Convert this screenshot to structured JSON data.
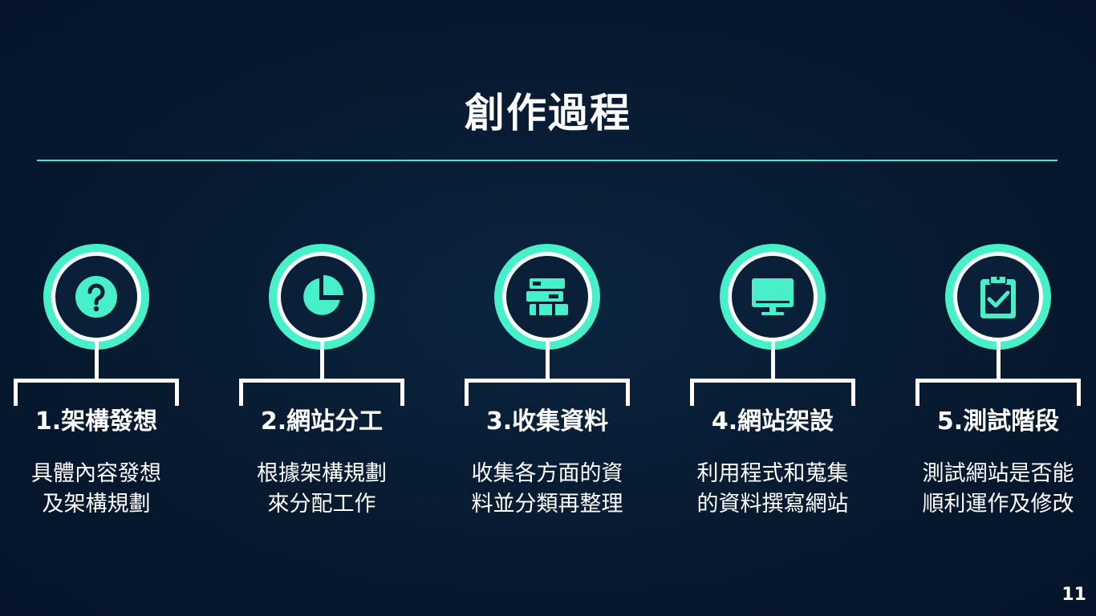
{
  "title": "創作過程",
  "page_number": "11",
  "colors": {
    "accent": "#47f0c8",
    "background": "#071a30",
    "text": "#ffffff"
  },
  "steps": [
    {
      "title": "1.架構發想",
      "desc_line1": "具體內容發想",
      "desc_line2": "及架構規劃",
      "icon": "question-icon"
    },
    {
      "title": "2.網站分工",
      "desc_line1": "根據架構規劃",
      "desc_line2": "來分配工作",
      "icon": "pie-chart-icon"
    },
    {
      "title": "3.收集資料",
      "desc_line1": "收集各方面的資",
      "desc_line2": "料並分類再整理",
      "icon": "books-icon"
    },
    {
      "title": "4.網站架設",
      "desc_line1": "利用程式和蒐集",
      "desc_line2": "的資料撰寫網站",
      "icon": "monitor-icon"
    },
    {
      "title": "5.測試階段",
      "desc_line1": "測試網站是否能",
      "desc_line2": "順利運作及修改",
      "icon": "clipboard-check-icon"
    }
  ]
}
